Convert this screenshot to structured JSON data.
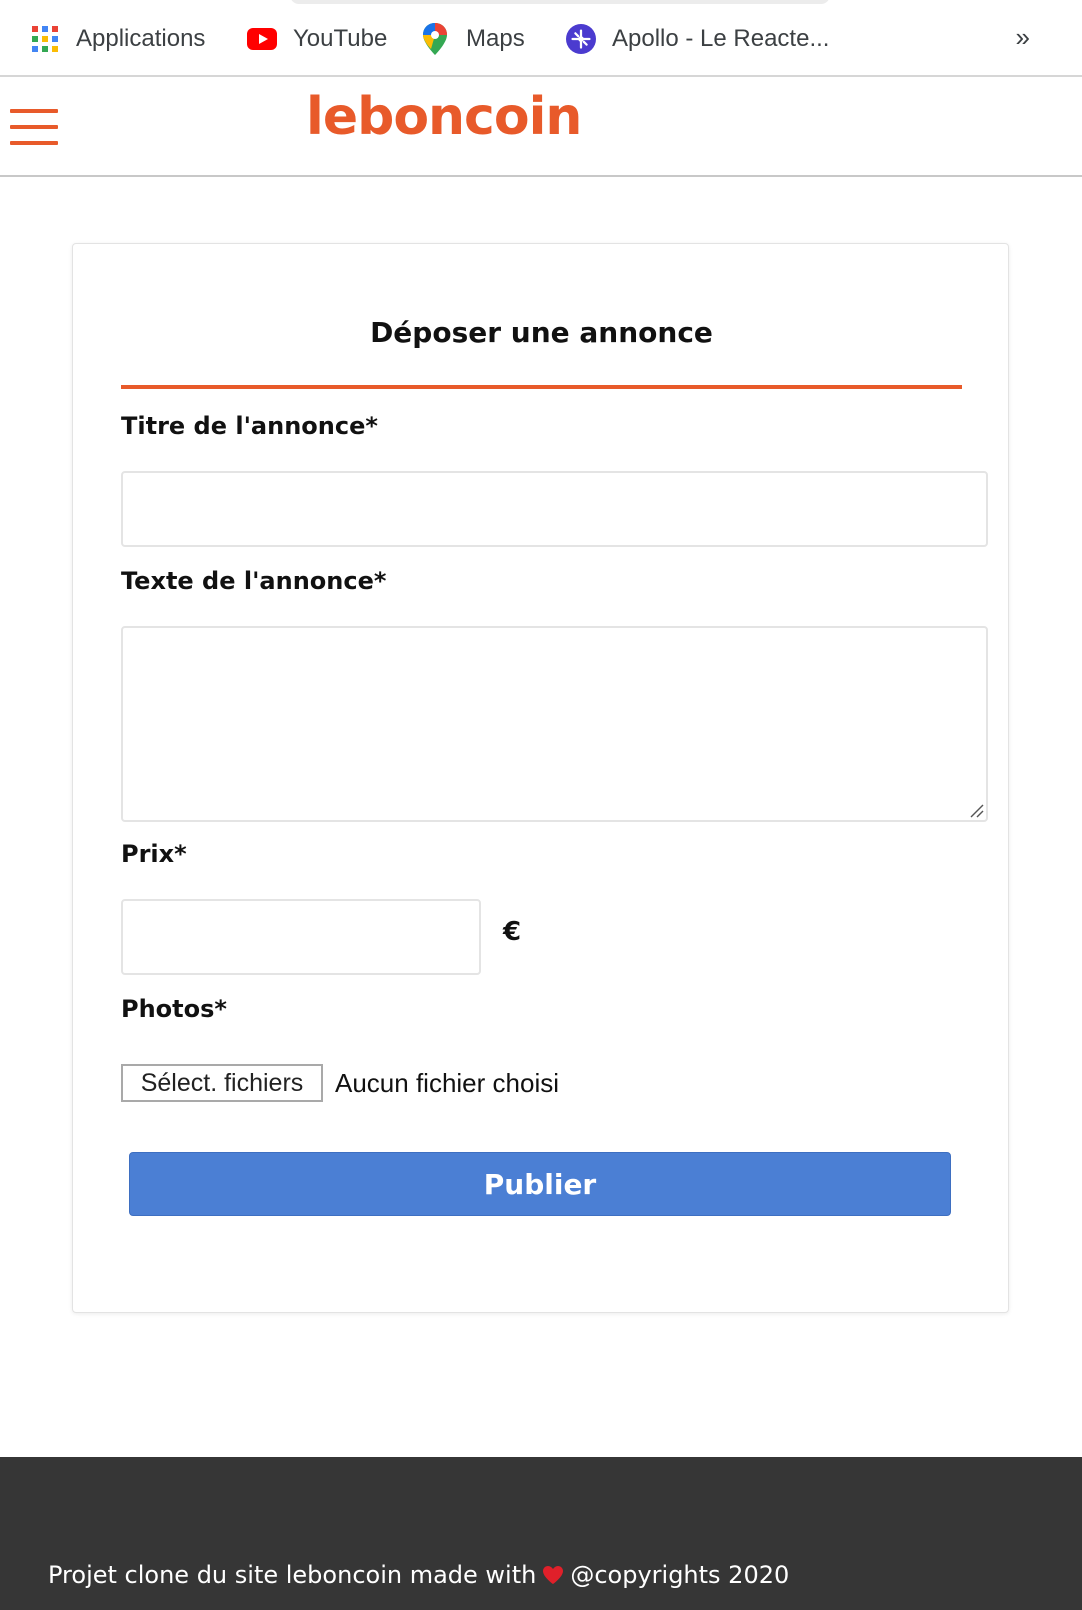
{
  "bookmarks": {
    "items": [
      {
        "label": "Applications",
        "icon": "apps-grid-icon"
      },
      {
        "label": "YouTube",
        "icon": "youtube-icon"
      },
      {
        "label": "Maps",
        "icon": "maps-pin-icon"
      },
      {
        "label": "Apollo - Le Reacte...",
        "icon": "apollo-icon"
      }
    ],
    "more_label": "»"
  },
  "header": {
    "logo_text": "leboncoin",
    "brand_color": "#e85a2a",
    "menu_icon": "hamburger-menu-icon"
  },
  "form": {
    "title": "Déposer une annonce",
    "title_label": "Titre de l'annonce*",
    "title_value": "",
    "text_label": "Texte de l'annonce*",
    "text_value": "",
    "price_label": "Prix*",
    "price_value": "",
    "currency": "€",
    "photos_label": "Photos*",
    "file_button_label": "Sélect. fichiers",
    "file_status": "Aucun fichier choisi",
    "submit_label": "Publier",
    "accent_color": "#4b7fd4"
  },
  "footer": {
    "text_before": "Projet clone du site leboncoin made with",
    "heart_icon": "heart-icon",
    "text_after": "@copyrights 2020"
  }
}
